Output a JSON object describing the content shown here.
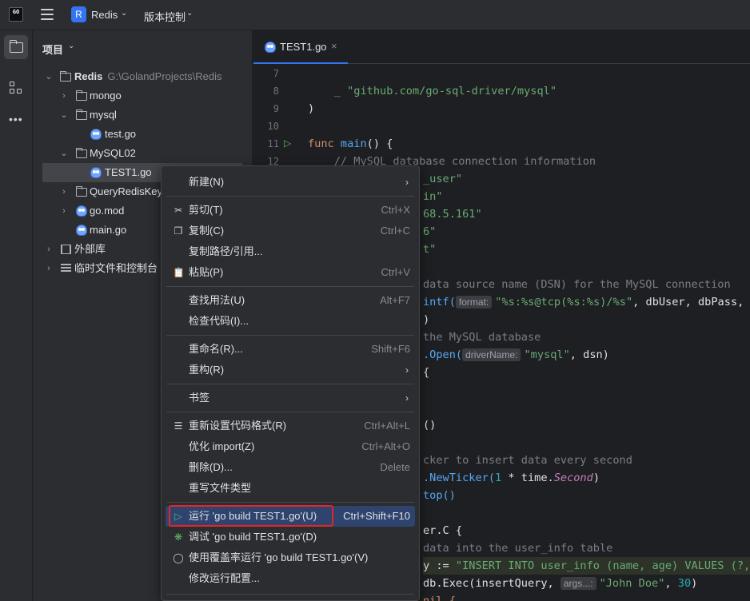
{
  "titlebar": {
    "logo_text": "GO",
    "project_badge": "R",
    "project_name": "Redis",
    "vcs_label": "版本控制"
  },
  "project_panel": {
    "title": "项目",
    "root_name": "Redis",
    "root_path": "G:\\GolandProjects\\Redis",
    "items": [
      {
        "label": "mongo"
      },
      {
        "label": "mysql"
      },
      {
        "label": "test.go"
      },
      {
        "label": "MySQL02"
      },
      {
        "label": "TEST1.go"
      },
      {
        "label": "QueryRedisKey"
      },
      {
        "label": "go.mod"
      },
      {
        "label": "main.go"
      },
      {
        "label": "外部库"
      },
      {
        "label": "临时文件和控制台"
      }
    ]
  },
  "editor": {
    "tab_label": "TEST1.go",
    "line_numbers": [
      "7",
      "8",
      "9",
      "10",
      "11",
      "12"
    ],
    "code": {
      "l8_under": "_ ",
      "l8_str": "\"github.com/go-sql-driver/mysql\"",
      "l9": ")",
      "l11_kw": "func ",
      "l11_fn": "main",
      "l11_rest": "() {",
      "l12": "    // MySQL database connection information",
      "l13": "_user\"",
      "l14": "in\"",
      "l15": "68.5.161\"",
      "l16": "6\"",
      "l17": "t\"",
      "l19": "data source name (DSN) for the MySQL connection",
      "l20_a": "intf(",
      "l20_hint": "format:",
      "l20_str": "\"%s:%s@tcp(%s:%s)/%s\"",
      "l20_rest": ", dbUser, dbPass,",
      "l21": ")",
      "l22": "the MySQL database",
      "l23_a": ".Open(",
      "l23_hint": "driverName:",
      "l23_str": "\"mysql\"",
      "l23_rest": ", dsn)",
      "l24": "{",
      "l27": "()",
      "l29": "cker to insert data every second",
      "l30_a": ".NewTicker(",
      "l30_num": "1",
      "l30_b": " * time.",
      "l30_it": "Second",
      "l30_c": ")",
      "l31": "top()",
      "l33": "er.C {",
      "l34": "data into the user_info table",
      "l35_a": "y := ",
      "l35_sql": "\"INSERT INTO user_info (name, age) VALUES (?,",
      "l36_a": "db.Exec(insertQuery, ",
      "l36_hint": "args...:",
      "l36_str": "\"John Doe\"",
      "l36_b": ", ",
      "l36_num": "30",
      "l36_c": ")",
      "l37": "nil {"
    }
  },
  "context_menu": {
    "items": [
      {
        "label": "新建(N)",
        "shortcut": ""
      },
      {
        "label": "剪切(T)",
        "shortcut": "Ctrl+X"
      },
      {
        "label": "复制(C)",
        "shortcut": "Ctrl+C"
      },
      {
        "label": "复制路径/引用...",
        "shortcut": ""
      },
      {
        "label": "粘贴(P)",
        "shortcut": "Ctrl+V"
      },
      {
        "label": "查找用法(U)",
        "shortcut": "Alt+F7"
      },
      {
        "label": "检查代码(I)...",
        "shortcut": ""
      },
      {
        "label": "重命名(R)...",
        "shortcut": "Shift+F6"
      },
      {
        "label": "重构(R)",
        "shortcut": ""
      },
      {
        "label": "书签",
        "shortcut": ""
      },
      {
        "label": "重新设置代码格式(R)",
        "shortcut": "Ctrl+Alt+L"
      },
      {
        "label": "优化 import(Z)",
        "shortcut": "Ctrl+Alt+O"
      },
      {
        "label": "删除(D)...",
        "shortcut": "Delete"
      },
      {
        "label": "重写文件类型",
        "shortcut": ""
      },
      {
        "label": "运行 'go build TEST1.go'(U)",
        "shortcut": "Ctrl+Shift+F10"
      },
      {
        "label": "调试 'go build TEST1.go'(D)",
        "shortcut": ""
      },
      {
        "label": "使用覆盖率运行 'go build TEST1.go'(V)",
        "shortcut": ""
      },
      {
        "label": "修改运行配置...",
        "shortcut": ""
      }
    ]
  },
  "colors": {
    "accent": "#3574f0",
    "highlight": "#2e436e",
    "red_box": "#e52626",
    "run_green": "#5fb865"
  }
}
